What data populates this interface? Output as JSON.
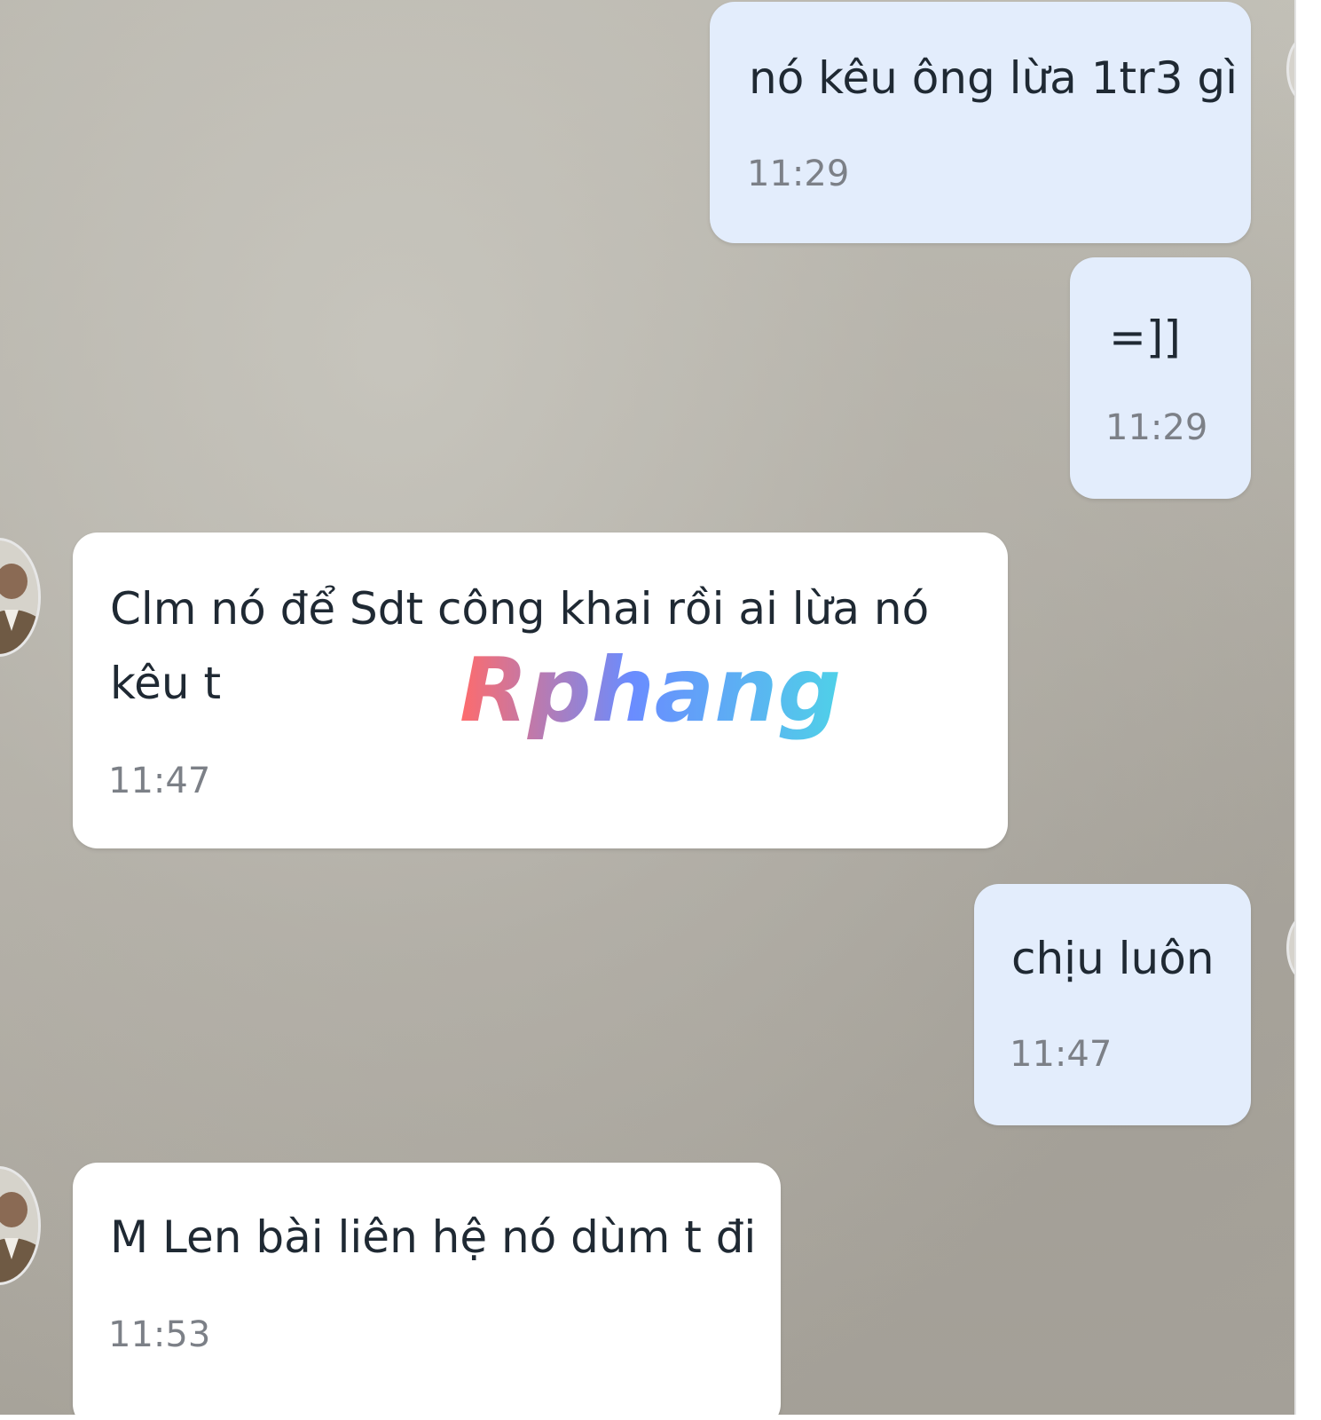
{
  "messages": [
    {
      "sender": "me",
      "text": "nó kêu ông lừa 1tr3 gì",
      "time": "11:29"
    },
    {
      "sender": "me",
      "text": "=]]",
      "time": "11:29"
    },
    {
      "sender": "other",
      "text": "Clm nó để Sdt công khai rồi ai lừa nó kêu t",
      "time": "11:47"
    },
    {
      "sender": "me",
      "text": "chịu luôn",
      "time": "11:47"
    },
    {
      "sender": "other",
      "text": "M Len bài liên hệ nó dùm t đi",
      "time": "11:53"
    }
  ],
  "watermark": {
    "text": "Rphang"
  },
  "colors": {
    "my_bubble": "#e3edfc",
    "their_bubble": "#ffffff",
    "message_text": "#1f2933",
    "time_text": "#7c8087",
    "watermark_start": "#ff6b6b",
    "watermark_mid": "#6a8cff",
    "watermark_end": "#4fd1e8"
  }
}
